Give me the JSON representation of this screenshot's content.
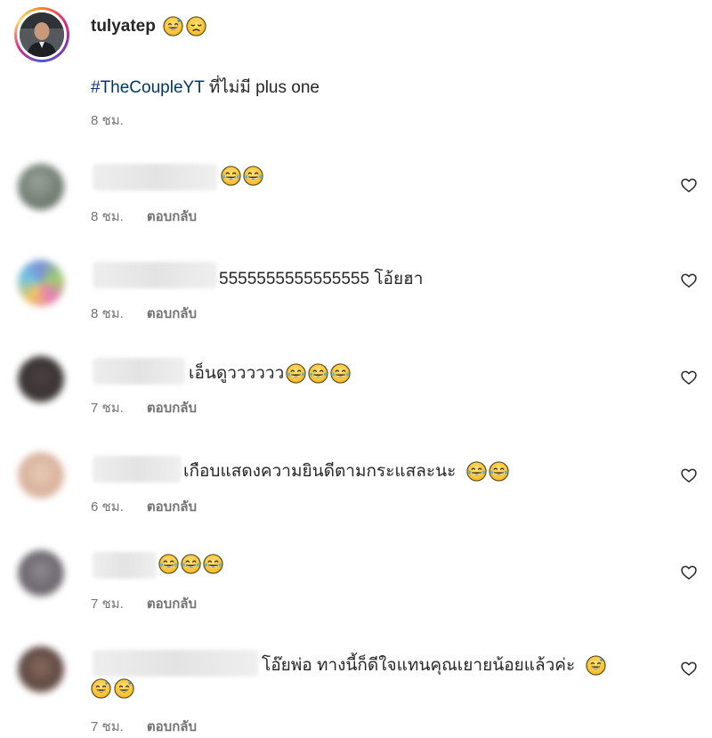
{
  "post": {
    "username": "tulyatep",
    "username_emojis": [
      "grinning-sweat-emoji",
      "disappointed-emoji"
    ],
    "hashtag": "#TheCoupleYT",
    "caption_rest": " ที่ไม่มี plus one",
    "time": "8 ชม."
  },
  "comments": [
    {
      "text": "",
      "emojis": [
        "joy-emoji",
        "joy-emoji"
      ],
      "time": "8 ชม.",
      "reply": "ตอบกลับ"
    },
    {
      "text": "5555555555555555 โอ้ยฮา",
      "emojis": [],
      "time": "8 ชม.",
      "reply": "ตอบกลับ"
    },
    {
      "text": "เอ็นดูวววววว",
      "emojis": [
        "joy-emoji",
        "joy-emoji",
        "joy-emoji"
      ],
      "time": "7 ชม.",
      "reply": "ตอบกลับ"
    },
    {
      "text": "เกือบแสดงความยินดีตามกระแสละนะ",
      "emojis": [
        "joy-emoji",
        "joy-emoji"
      ],
      "time": "6 ชม.",
      "reply": "ตอบกลับ"
    },
    {
      "text": "",
      "emojis": [
        "joy-emoji",
        "joy-emoji",
        "joy-emoji"
      ],
      "time": "7 ชม.",
      "reply": "ตอบกลับ"
    },
    {
      "text": "โอ๊ยพ่อ ทางนี้ก็ดีใจแทนคุณเยายน้อยแล้วค่ะ",
      "emojis": [
        "grinning-sweat-emoji"
      ],
      "emojis_line2": [
        "grinning-sweat-emoji",
        "grinning-sweat-emoji"
      ],
      "time": "7 ชม.",
      "reply": "ตอบกลับ"
    }
  ],
  "colors": {
    "text": "#262626",
    "muted": "#737373",
    "hashtag": "#00376b"
  }
}
